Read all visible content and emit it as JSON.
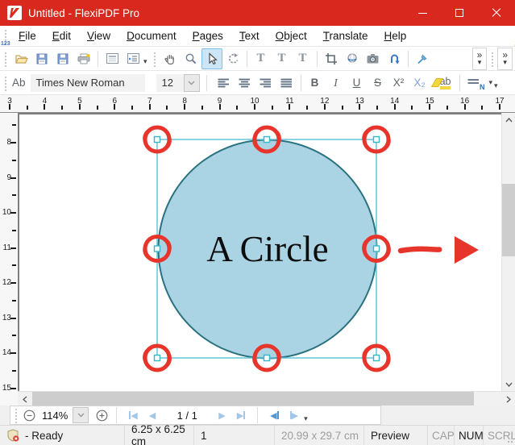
{
  "window": {
    "title": "Untitled - FlexiPDF Pro"
  },
  "menu": {
    "items": [
      "File",
      "Edit",
      "View",
      "Document",
      "Pages",
      "Text",
      "Object",
      "Translate",
      "Help"
    ]
  },
  "glyphs": {
    "overflow": "»",
    "dropdown": "▾",
    "prev": "◀",
    "next": "▶",
    "star": "★"
  },
  "toolbar": {
    "edit_text_label": "T",
    "add_text_label": "T",
    "numbering_label": "T",
    "numbering_digits": "123"
  },
  "format": {
    "sample_label": "Ab",
    "font_name": "Times New Roman",
    "font_size": "12",
    "bold": "B",
    "italic": "I",
    "underline": "U",
    "strikethrough": "S",
    "superscript": "X²",
    "subscript": "X₂",
    "highlight": "ab",
    "line_spacing": "N"
  },
  "rulers": {
    "horizontal_numbers": [
      "3",
      "4",
      "5",
      "6",
      "7",
      "8",
      "9",
      "10",
      "11",
      "12",
      "13",
      "14",
      "15",
      "16",
      "17"
    ],
    "vertical_numbers": [
      "8",
      "9",
      "10",
      "11",
      "12",
      "13",
      "14",
      "15"
    ]
  },
  "canvas": {
    "shape_label": "A Circle"
  },
  "zoombar": {
    "zoom_level": "114%",
    "page_indicator": "1 / 1"
  },
  "statusbar": {
    "ready": "-  Ready",
    "selection_size": "6.25 x 6.25 cm",
    "page_number": "1",
    "page_size": "20.99 x 29.7 cm",
    "view_mode": "Preview",
    "caps": "CAP",
    "num": "NUM",
    "scroll": "SCRL"
  },
  "colors": {
    "titlebar": "#d9291e",
    "annotation_red": "#e8352b",
    "circle_fill": "#aad4e3",
    "circle_stroke": "#2a7280",
    "selection": "#56c2d5"
  }
}
